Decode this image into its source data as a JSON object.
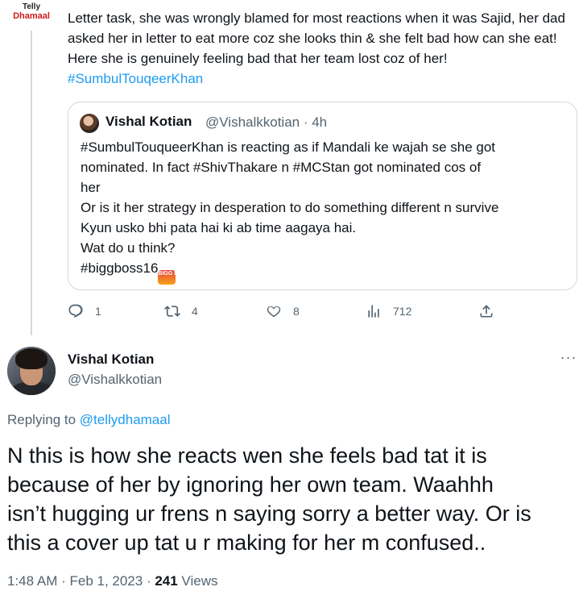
{
  "parent_tweet": {
    "source_logo": {
      "line1": "Telly",
      "line2": "Dhamaal"
    },
    "text_main": "Letter task, she was wrongly blamed for most reactions when it was Sajid, her dad asked her in letter to eat more coz she looks thin & she felt bad how can she eat! Here she is genuinely feeling bad that her team lost coz of her!",
    "hashtag": "#SumbulTouqeerKhan",
    "quoted_tweet": {
      "author_name": "Vishal Kotian",
      "author_handle": "@Vishalkkotian · 4h",
      "lines": [
        "#SumbulTouqueerKhan is reacting as if Mandali ke wajah se she got",
        "nominated. In fact #ShivThakare n #MCStan got nominated cos of",
        "her",
        "Or is it her strategy in desperation to do something different n survive",
        "Kyun usko bhi pata hai ki ab time aagaya hai.",
        "Wat do u think?"
      ],
      "last_line_text": "#biggboss16",
      "badge_text": "BIGG BOSS"
    },
    "actions": {
      "reply_count": "1",
      "retweet_count": "4",
      "like_count": "8",
      "view_count": "712"
    }
  },
  "main_tweet": {
    "author_name": "Vishal Kotian",
    "author_handle": "@Vishalkkotian",
    "more_icon": "···",
    "replying_prefix": "Replying to",
    "replying_handle": "@tellydhamaal",
    "lines": [
      "N this is how she reacts wen she feels bad tat it is",
      "because of her by ignoring her own team. Waahhh",
      "isn’t hugging ur frens n saying sorry a better way. Or is",
      "this a cover up tat u r making for her m confused.."
    ],
    "timestamp": "1:48 AM · Feb 1, 2023 · ",
    "views_count": "241",
    "views_label": " Views"
  },
  "colors": {
    "accent": "#1d9bf0",
    "text_primary": "#0f1419",
    "text_secondary": "#536471",
    "border": "#cfd9de"
  },
  "icons": [
    "reply-icon",
    "retweet-icon",
    "like-icon",
    "views-icon",
    "share-icon",
    "more-icon"
  ]
}
